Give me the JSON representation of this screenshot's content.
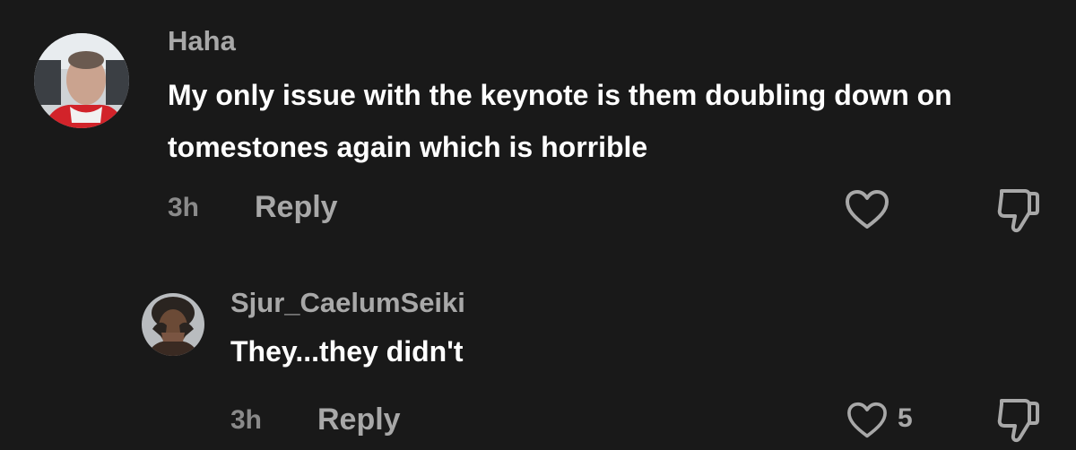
{
  "comments": [
    {
      "username": "Haha",
      "text": "My only issue with the keynote is them doubling down on tomestones again which is horrible",
      "time": "3h",
      "reply_label": "Reply",
      "like_count": "",
      "avatar_icon": "user-avatar-photo"
    },
    {
      "username": "Sjur_CaelumSeiki",
      "text": "They...they didn't",
      "time": "3h",
      "reply_label": "Reply",
      "like_count": "5",
      "avatar_icon": "user-avatar-photo"
    }
  ],
  "icons": {
    "like": "heart-icon",
    "dislike": "thumbs-down-icon"
  },
  "colors": {
    "background": "#191919",
    "primary_text": "#ffffff",
    "secondary_text": "#a8a8a8",
    "muted_text": "#8a8a8a"
  }
}
